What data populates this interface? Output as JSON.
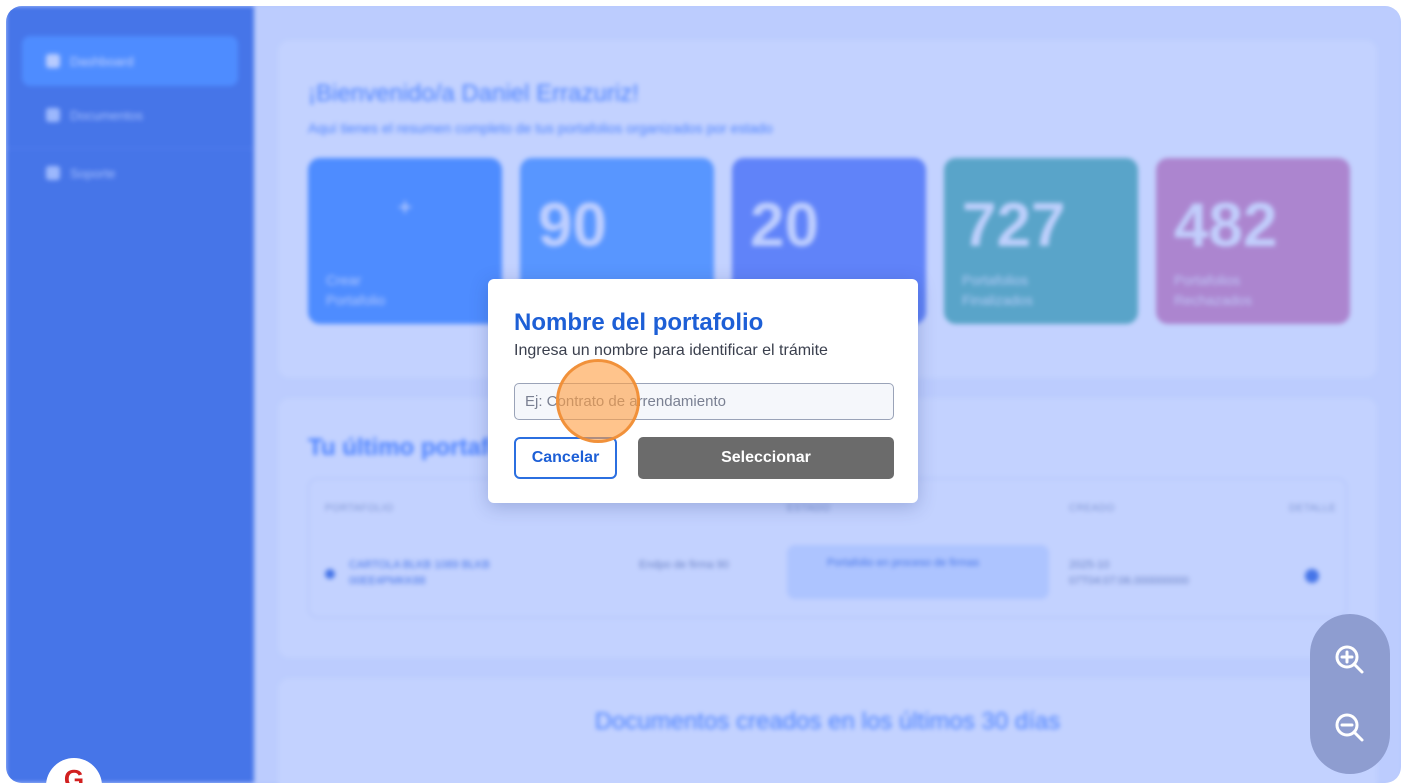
{
  "sidebar": {
    "items": [
      {
        "label": "Dashboard",
        "active": true
      },
      {
        "label": "Documentos",
        "active": false
      },
      {
        "label": "Soporte",
        "active": false
      }
    ]
  },
  "welcome": {
    "title": "¡Bienvenido/a Daniel Errazuriz!",
    "subtitle": "Aquí tienes el resumen completo de tus portafolios organizados por estado"
  },
  "stats": [
    {
      "value": "+",
      "label": "Crear Portafolio",
      "color": "#3d8bff"
    },
    {
      "value": "90",
      "label": "",
      "color": "#4e9bff"
    },
    {
      "value": "20",
      "label": "",
      "color": "#5b7cf5"
    },
    {
      "value": "727",
      "label": "Portafolios Finalizados",
      "color": "#4fb3a5"
    },
    {
      "value": "482",
      "label": "Portafolios Rechazados",
      "color": "#d97fb0"
    }
  ],
  "recent": {
    "title": "Tu último portafolio",
    "columns": [
      "PORTAFOLIO",
      "",
      "ESTADO",
      "CREADO",
      "DETALLE"
    ],
    "row": {
      "portfolio": "CARTOLA BLKB 1089 BLKB 00EE4PMKK88",
      "type": "Endpo de firma 90",
      "status": "Portafolio en proceso de firmas",
      "created": "2025-10 07T04:07:06.000000000"
    }
  },
  "docs": {
    "title": "Documentos creados en los últimos 30 días"
  },
  "modal": {
    "title": "Nombre del portafolio",
    "subtitle": "Ingresa un nombre para identificar el trámite",
    "input_placeholder": "Ej: Contrato de arrendamiento",
    "input_value": "",
    "cancel_label": "Cancelar",
    "select_label": "Seleccionar"
  },
  "zoom": {
    "in_icon": "zoom-in-icon",
    "out_icon": "zoom-out-icon"
  },
  "avatar_initial": "G",
  "colors": {
    "primary": "#1d5fd6",
    "sidebar": "#2f64d9",
    "select_button": "#6b6b6b",
    "overlay": "#6a8eff"
  }
}
